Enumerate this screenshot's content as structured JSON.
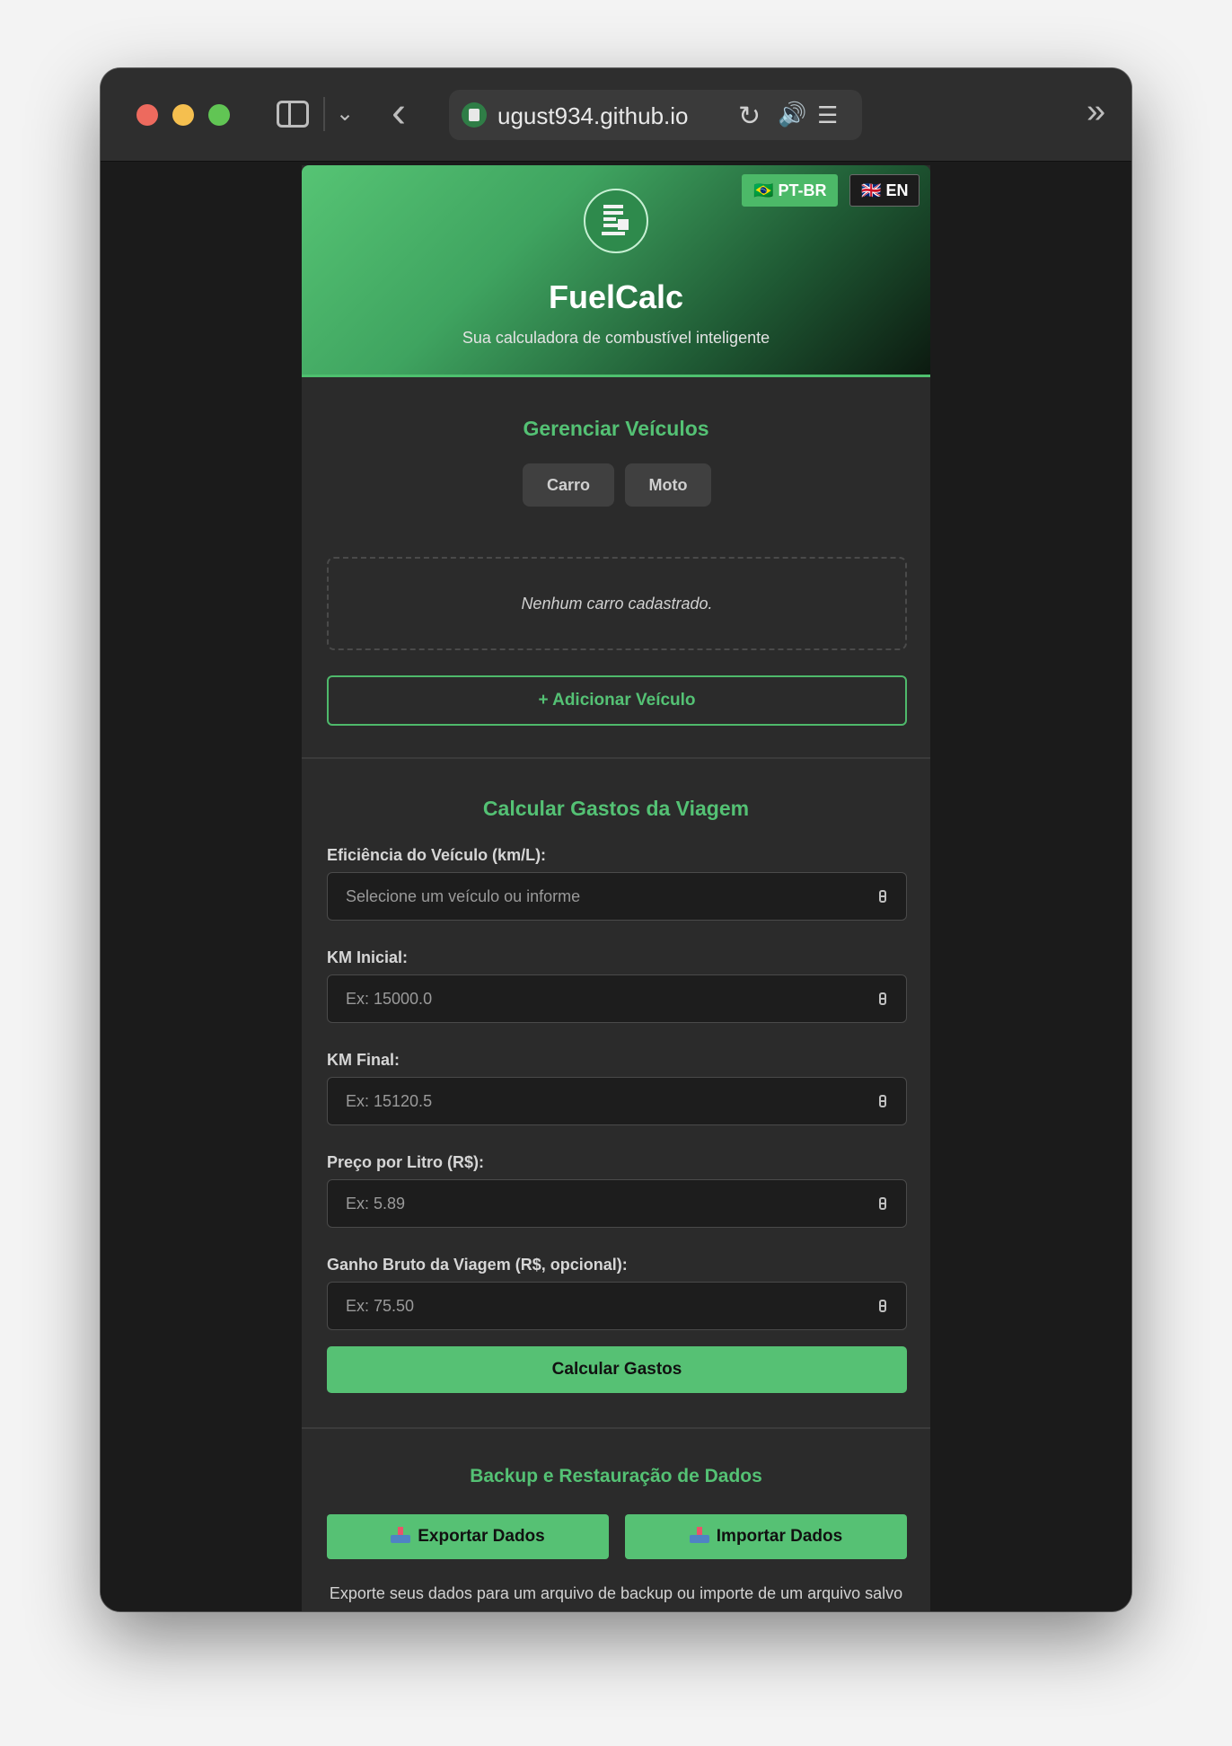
{
  "browser": {
    "url": "ugust934.github.io",
    "icons": {
      "sidebar": "sidebar-icon",
      "chevron": "chevron-down-icon",
      "back": "back-arrow-icon",
      "reload": "reload-icon",
      "sound": "speaker-icon",
      "reader": "reader-icon",
      "more": "double-chevron-right-icon"
    },
    "glyphs": {
      "chevron": "⌄",
      "back": "‹",
      "reload": "↻",
      "sound": "🔊",
      "reader": "☰",
      "more": "»"
    }
  },
  "header": {
    "languages": [
      {
        "flag": "🇧🇷",
        "label": "PT-BR",
        "active": true
      },
      {
        "flag": "🇬🇧",
        "label": "EN",
        "active": false
      }
    ],
    "logo_icon": "calculator-pump-icon",
    "title": "FuelCalc",
    "subtitle": "Sua calculadora de combustível inteligente",
    "accent_color": "#54c174"
  },
  "vehicles": {
    "title": "Gerenciar Veículos",
    "types": [
      "Carro",
      "Moto"
    ],
    "empty_message": "Nenhum carro cadastrado.",
    "add_button": "+ Adicionar Veículo"
  },
  "trip": {
    "title": "Calcular Gastos da Viagem",
    "fields": [
      {
        "label": "Eficiência do Veículo (km/L):",
        "placeholder": "Selecione um veículo ou informe",
        "value": ""
      },
      {
        "label": "KM Inicial:",
        "placeholder": "Ex: 15000.0",
        "value": ""
      },
      {
        "label": "KM Final:",
        "placeholder": "Ex: 15120.5",
        "value": ""
      },
      {
        "label": "Preço por Litro (R$):",
        "placeholder": "Ex: 5.89",
        "value": ""
      },
      {
        "label": "Ganho Bruto da Viagem (R$, opcional):",
        "placeholder": "Ex: 75.50",
        "value": ""
      }
    ],
    "submit": "Calcular Gastos"
  },
  "backup": {
    "title": "Backup e Restauração de Dados",
    "export_label": "Exportar Dados",
    "import_label": "Importar Dados",
    "icon": "inbox-tray-icon",
    "note": "Exporte seus dados para um arquivo de backup ou importe de um arquivo salvo"
  }
}
